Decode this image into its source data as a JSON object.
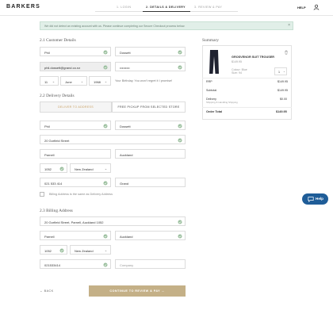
{
  "header": {
    "logo": "BARKERS",
    "steps": [
      "1. LOGIN",
      "2. DETAILS & DELIVERY",
      "3. REVIEW & PAY"
    ],
    "help": "HELP"
  },
  "notice": {
    "text": "We did not detect an existing account with us. Please continue completing our Secure Checkout process below.",
    "close": "×"
  },
  "customer_details": {
    "heading": "2.1 Customer Details",
    "first_name": "Phil",
    "last_name": "Dossett",
    "email": "phil.dossett@grand.co.nz",
    "password": "•••••••••",
    "dob_day": "11",
    "dob_month": "June",
    "dob_year": "1968",
    "birthday_note": "Your Birthday. You won't regret it I promise!"
  },
  "delivery_details": {
    "heading": "2.2 Delivery Details",
    "tab_deliver": "DELIVER TO ADDRESS",
    "tab_pickup": "FREE PICKUP FROM SELECTED STORE",
    "first_name": "Phil",
    "last_name": "Dossett",
    "street": "20 Gorfield Street",
    "suburb": "Parnell",
    "city": "Auckland",
    "postcode": "1052",
    "country": "New Zealand",
    "phone": "021 533 414",
    "company": "Grand",
    "billing_same": "Billing Address is the same as Delivery Address"
  },
  "billing_address": {
    "heading": "2.3 Billing Address",
    "address": "20 Gorfield Street, Parnell, Auckland 1052",
    "suburb": "Parnell",
    "city": "Auckland",
    "postcode": "1052",
    "country": "New Zealand",
    "phone": "021533414",
    "company_placeholder": "Company"
  },
  "actions": {
    "back": "BACK",
    "continue": "CONTINUE TO REVIEW & PAY"
  },
  "summary": {
    "heading": "Summary",
    "product_name": "GROSVENOR SUIT TROUSER",
    "product_price": "$149.95",
    "colour": "Colour: Blue",
    "size": "Size: 94",
    "qty": "1",
    "rrp_label": "RRP",
    "rrp_value": "$149.95",
    "subtotal_label": "Subtotal",
    "subtotal_value": "$149.95",
    "delivery_label": "Delivery",
    "delivery_sub": "Shipping & Handling Shipping",
    "delivery_value": "$0.00",
    "total_label": "Order Total",
    "total_value": "$149.95"
  },
  "help_widget": {
    "label": "Help"
  },
  "colors": {
    "accent": "#c4b087",
    "notice_bg": "#e1efe8",
    "valid": "#9bbf9e",
    "help": "#1f5d98"
  }
}
